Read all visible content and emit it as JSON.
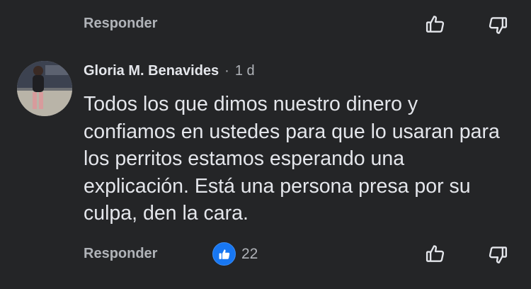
{
  "previous_comment": {
    "reply_label": "Responder",
    "like_icon": "thumbs-up-icon",
    "dislike_icon": "thumbs-down-icon"
  },
  "comment": {
    "author": "Gloria M. Benavides",
    "separator": "·",
    "timestamp": "1 d",
    "text": "Todos los que dimos nuestro dinero y confiamos en ustedes para que lo usaran para los perritos estamos esperando una explicación. Está una persona presa por su culpa, den la cara.",
    "reply_label": "Responder",
    "reaction_icon": "like-reaction-icon",
    "reaction_count": "22",
    "like_icon": "thumbs-up-icon",
    "dislike_icon": "thumbs-down-icon"
  },
  "colors": {
    "background": "#242527",
    "primary_text": "#e4e6eb",
    "secondary_text": "#b0b3b8",
    "like_blue": "#1877f2"
  }
}
